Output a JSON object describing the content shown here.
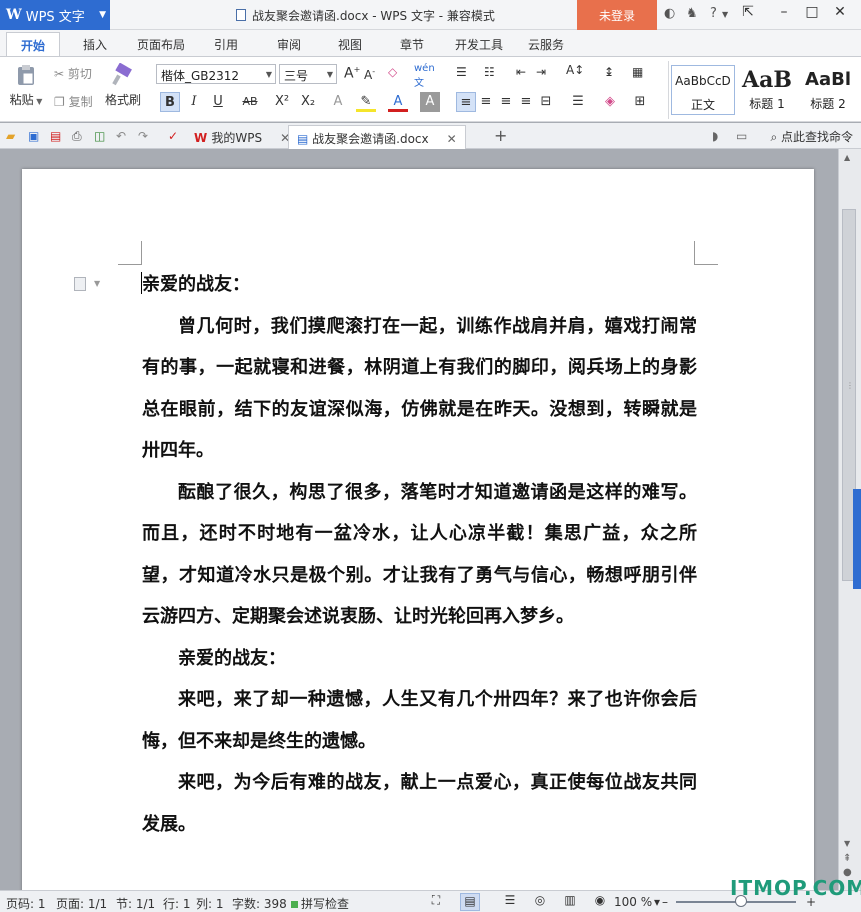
{
  "titlebar": {
    "app_name": "WPS 文字",
    "document_title": "战友聚会邀请函.docx - WPS 文字 - 兼容模式",
    "login_label": "未登录"
  },
  "menu": {
    "tabs": [
      "开始",
      "插入",
      "页面布局",
      "引用",
      "审阅",
      "视图",
      "章节",
      "开发工具",
      "云服务"
    ]
  },
  "ribbon": {
    "paste_label": "粘贴",
    "cut_label": "剪切",
    "copy_label": "复制",
    "format_painter_label": "格式刷",
    "font_name": "楷体_GB2312",
    "font_size": "三号",
    "styles": [
      {
        "sample": "AaBbCcD",
        "name": "正文"
      },
      {
        "sample": "AaB",
        "name": "标题 1"
      },
      {
        "sample": "AaBl",
        "name": "标题 2"
      }
    ]
  },
  "doc_tabs": {
    "tab1": "我的WPS",
    "tab2": "战友聚会邀请函.docx",
    "search_command": "点此查找命令"
  },
  "document": {
    "paragraphs": [
      {
        "text": "亲爱的战友：",
        "indent": false
      },
      {
        "text": "曾几何时，我们摸爬滚打在一起，训练作战肩并肩，嬉戏打闹常有的事，一起就寝和进餐，林阴道上有我们的脚印，阅兵场上的身影总在眼前，结下的友谊深似海，仿佛就是在昨天。没想到，转瞬就是卅四年。",
        "indent": true
      },
      {
        "text": "酝酿了很久，构思了很多，落笔时才知道邀请函是这样的难写。而且，还时不时地有一盆冷水，让人心凉半截！集思广益，众之所望，才知道冷水只是极个别。才让我有了勇气与信心，畅想呼朋引伴云游四方、定期聚会述说衷肠、让时光轮回再入梦乡。",
        "indent": true
      },
      {
        "text": "亲爱的战友：",
        "indent": true
      },
      {
        "text": "来吧，来了却一种遗憾，人生又有几个卅四年？来了也许你会后悔，但不来却是终生的遗憾。",
        "indent": true
      },
      {
        "text": "来吧，为今后有难的战友，献上一点爱心，真正使每位战友共同发展。",
        "indent": true
      }
    ]
  },
  "status": {
    "page_no": "页码: 1",
    "page_count": "页面: 1/1",
    "section": "节: 1/1",
    "row": "行: 1",
    "col": "列: 1",
    "word_count": "字数: 398",
    "spell_check": "拼写检查",
    "zoom": "100 %"
  },
  "watermark": "ITMOP.COM",
  "colors": {
    "accent": "#2e6cd1",
    "login": "#e8704c",
    "watermark": "#1f9b7a"
  }
}
